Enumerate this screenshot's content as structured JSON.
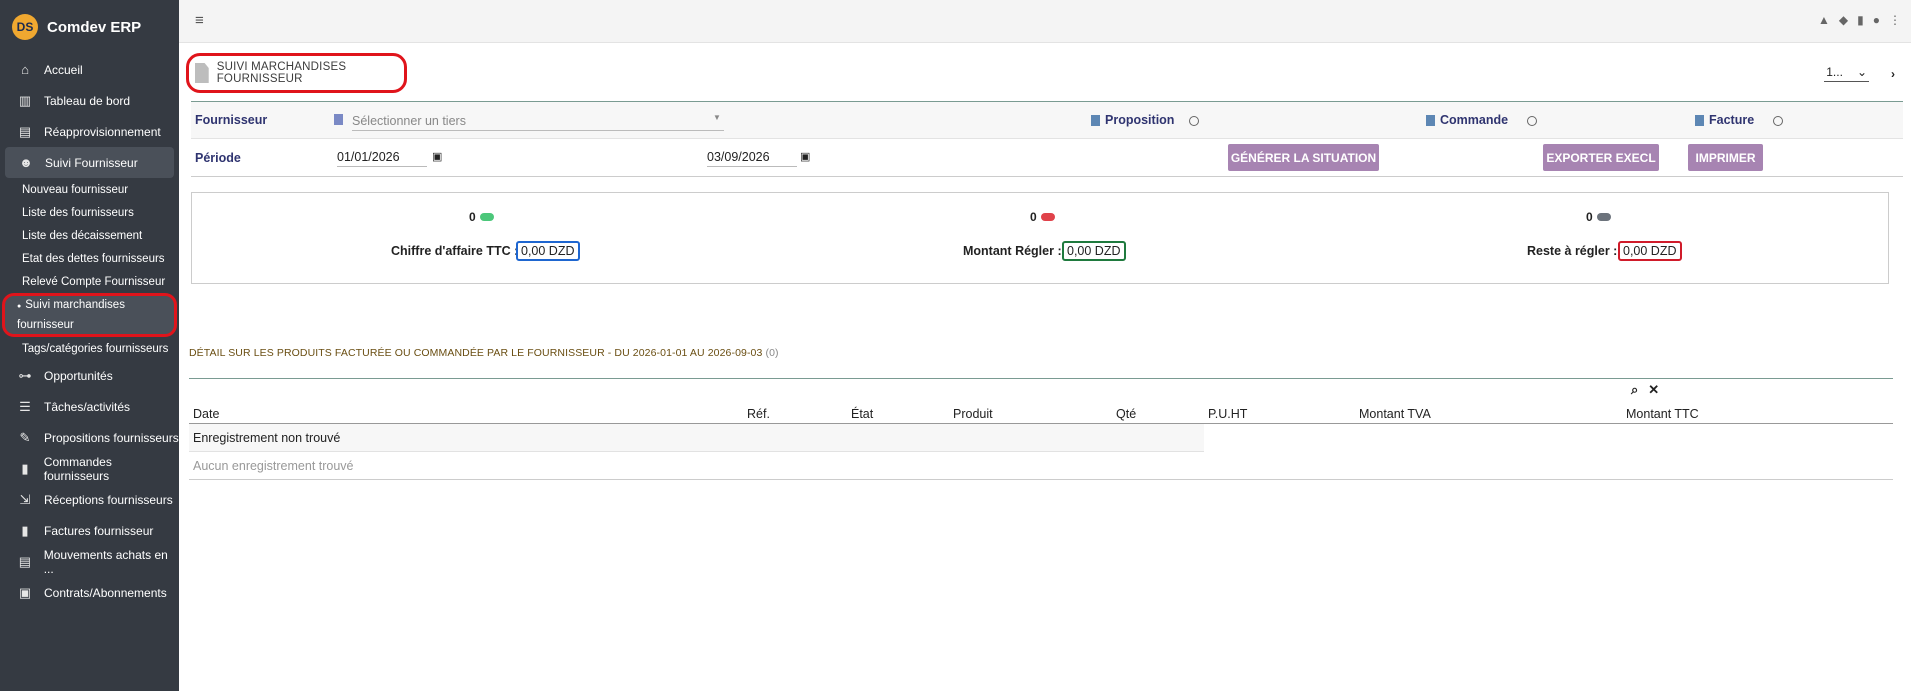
{
  "sidebar": {
    "brand": "Comdev ERP",
    "logo_text": "DS",
    "items": [
      {
        "label": "Accueil",
        "icon": "home-icon",
        "glyph": "⌂"
      },
      {
        "label": "Tableau de bord",
        "icon": "chart-icon",
        "glyph": "▥"
      },
      {
        "label": "Réapprovisionnement",
        "icon": "boxes-icon",
        "glyph": "▤"
      },
      {
        "label": "Suivi Fournisseur",
        "icon": "users-icon",
        "glyph": "☻"
      }
    ],
    "subitems": [
      "Nouveau fournisseur",
      "Liste des fournisseurs",
      "Liste des décaissement",
      "Etat des dettes fournisseurs",
      "Relevé Compte Fournisseur"
    ],
    "current_sub_line1": "Suivi marchandises",
    "current_sub_line2": "fournisseur",
    "after_sub": "Tags/catégories fournisseurs",
    "items2": [
      {
        "label": "Opportunités",
        "icon": "sitemap-icon",
        "glyph": "⊶"
      },
      {
        "label": "Tâches/activités",
        "icon": "tasks-icon",
        "glyph": "☰"
      },
      {
        "label": "Propositions fournisseurs",
        "icon": "file-edit-icon",
        "glyph": "✎"
      },
      {
        "label": "Commandes fournisseurs",
        "icon": "file-icon",
        "glyph": "▮"
      },
      {
        "label": "Réceptions fournisseurs",
        "icon": "dolly-icon",
        "glyph": "⇲"
      },
      {
        "label": "Factures fournisseur",
        "icon": "invoice-icon",
        "glyph": "▮"
      },
      {
        "label": "Mouvements achats en ...",
        "icon": "boxes-icon",
        "glyph": "▤"
      },
      {
        "label": "Contrats/Abonnements",
        "icon": "suitcase-icon",
        "glyph": "▣"
      }
    ]
  },
  "topbar": {
    "menu_glyph": "≡"
  },
  "page": {
    "title": "SUIVI MARCHANDISES FOURNISSEUR",
    "pager_value": "1...",
    "filters": {
      "fournisseur_label": "Fournisseur",
      "fournisseur_placeholder": "Sélectionner un tiers",
      "proposition_label": "Proposition",
      "commande_label": "Commande",
      "facture_label": "Facture",
      "periode_label": "Période",
      "date_from": "01/01/2026",
      "date_to": "03/09/2026",
      "btn_generer": "GÉNÉRER LA SITUATION",
      "btn_exporter": "EXPORTER EXECL",
      "btn_imprimer": "IMPRIMER"
    },
    "summary": [
      {
        "count": "0",
        "label": "Chiffre d'affaire TTC :",
        "amount": "0,00 DZD",
        "pill_color": "#4cc77a",
        "border_color": "#1e66d0"
      },
      {
        "count": "0",
        "label": "Montant Régler :",
        "amount": "0,00 DZD",
        "pill_color": "#e0424a",
        "border_color": "#1f7a3e"
      },
      {
        "count": "0",
        "label": "Reste à régler :",
        "amount": "0,00 DZD",
        "pill_color": "#6c737c",
        "border_color": "#d01b2a"
      }
    ],
    "detail_title": "DÉTAIL SUR LES PRODUITS FACTURÉE OU COMMANDÉE PAR LE FOURNISSEUR - DU 2026-01-01 AU 2026-09-03",
    "detail_count": "(0)",
    "table": {
      "columns": [
        "Date",
        "Réf.",
        "État",
        "Produit",
        "Qté",
        "P.U.HT",
        "Montant TVA",
        "Montant TTC"
      ],
      "row_not_found": "Enregistrement non trouvé",
      "row_empty": "Aucun enregistrement trouvé"
    }
  }
}
